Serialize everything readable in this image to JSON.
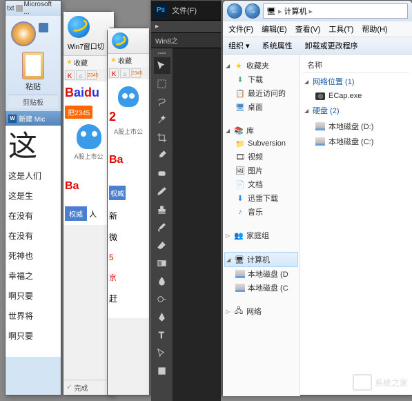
{
  "word": {
    "title_prefix": "txt",
    "title": "Microsoft ...",
    "paste": "粘贴",
    "clipboard_group": "剪贴板",
    "doc_tab": "新建 Mic",
    "big_char": "这",
    "lines": [
      "这是人们",
      "这是生",
      "在没有",
      "在没有",
      "死神也",
      "幸福之",
      "啊只要",
      "世界将",
      "啊只要"
    ]
  },
  "ie1": {
    "tab": "Win7窗口切",
    "favorites": "收藏",
    "baidu": "Baidu",
    "put2345": "把2345",
    "stock_txt": "A股上市公",
    "auth": "权威",
    "ren": "人",
    "done": "完成"
  },
  "ie2": {
    "favorites": "收藏",
    "baidu_short": "Ba",
    "lines": [
      "新",
      "微",
      "5",
      "京",
      "赶"
    ]
  },
  "ps": {
    "file_menu": "文件(F)",
    "tab": "Win8之"
  },
  "explorer": {
    "addr": "计算机",
    "menus": [
      "文件(F)",
      "编辑(E)",
      "查看(V)",
      "工具(T)",
      "帮助(H)"
    ],
    "cmds": [
      "组织",
      "系统属性",
      "卸载或更改程序"
    ],
    "col_name": "名称",
    "nav": {
      "favorites": "收藏夹",
      "downloads": "下载",
      "recent": "最近访问的",
      "desktop": "桌面",
      "library": "库",
      "subversion": "Subversion",
      "video": "视频",
      "pictures": "图片",
      "documents": "文档",
      "xunlei": "迅雷下载",
      "music": "音乐",
      "homegroup": "家庭组",
      "computer": "计算机",
      "disk_d": "本地磁盘 (D",
      "disk_c": "本地磁盘 (C",
      "network": "网络"
    },
    "content": {
      "netloc": "网络位置 (1)",
      "ecap": "ECap.exe",
      "hdd": "硬盘 (2)",
      "disk_d": "本地磁盘 (D:)",
      "disk_c": "本地磁盘 (C:)"
    }
  },
  "watermark": "系统之家"
}
